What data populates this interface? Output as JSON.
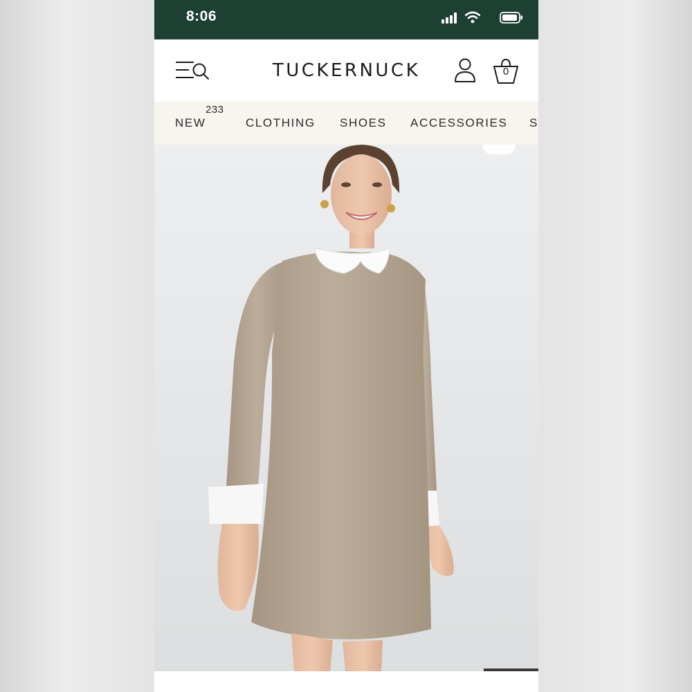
{
  "status_bar": {
    "time": "8:06",
    "icons": [
      "signal-icon",
      "wifi-icon",
      "battery-icon"
    ],
    "background": "#1d4032"
  },
  "header": {
    "brand": "TUCKERNUCK",
    "menu_icon": "menu-search-icon",
    "account_icon": "account-icon",
    "bag_icon": "shopping-bag-icon",
    "bag_count": "0"
  },
  "nav": {
    "items": [
      {
        "label": "NEW",
        "badge": "233"
      },
      {
        "label": "CLOTHING"
      },
      {
        "label": "SHOES"
      },
      {
        "label": "ACCESSORIES"
      },
      {
        "label": "S"
      }
    ],
    "background": "#f8f5ef"
  },
  "product_image": {
    "subject": "model-in-taupe-shift-dress-with-white-collar",
    "dress_color": "#b7a794"
  }
}
